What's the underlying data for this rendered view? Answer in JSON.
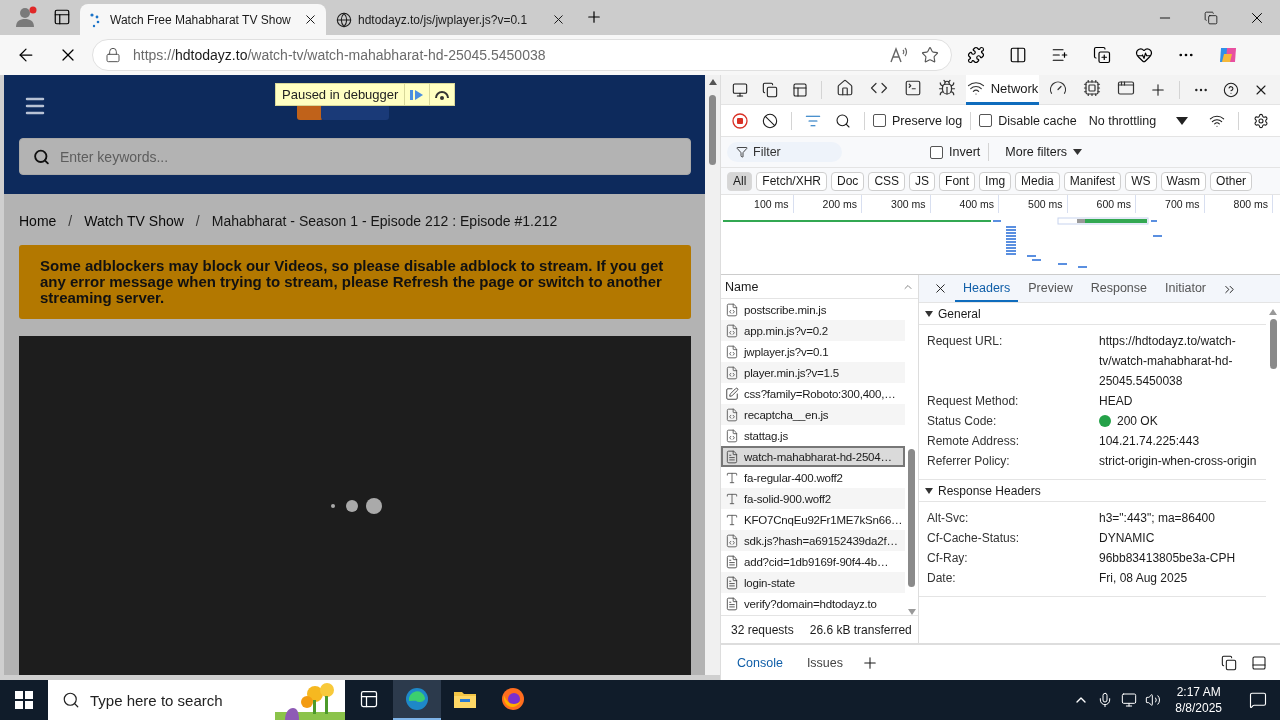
{
  "browser": {
    "tabs": [
      {
        "title": "Watch Free Mahabharat TV Show",
        "kind": "loading",
        "selected": true
      },
      {
        "title": "hdtodayz.to/js/jwplayer.js?v=0.1",
        "kind": "globe",
        "selected": false
      }
    ],
    "address": {
      "scheme": "https://",
      "host": "hdtodayz.to",
      "path": "/watch-tv/watch-mahabharat-hd-25045.5450038"
    },
    "loading": true
  },
  "page": {
    "debugger_badge": "Paused in debugger",
    "search": {
      "placeholder": "Enter keywords..."
    },
    "breadcrumbs": [
      {
        "label": "Home",
        "kind": "link"
      },
      {
        "label": "/",
        "kind": "separator"
      },
      {
        "label": "Watch TV Show",
        "kind": "link"
      },
      {
        "label": "/",
        "kind": "separator"
      },
      {
        "label": "Mahabharat - Season 1 - Episode 212 : Episode #1.212",
        "kind": "current"
      }
    ],
    "notice": "Some adblockers may block our Videos, so please disable adblock to stream. If you get any error message when trying to stream, please Refresh the page or switch to another streaming server."
  },
  "devtools": {
    "panel_tabs": [
      {
        "kind": "home",
        "selected": false
      },
      {
        "kind": "elements",
        "selected": false
      },
      {
        "kind": "console",
        "selected": false
      },
      {
        "kind": "sources",
        "selected": false
      },
      {
        "kind": "network",
        "label": "Network",
        "selected": true
      },
      {
        "kind": "performance",
        "selected": false
      },
      {
        "kind": "memory",
        "selected": false
      },
      {
        "kind": "application",
        "selected": false
      }
    ],
    "recording": true,
    "preserve_log": {
      "label": "Preserve log",
      "checked": false
    },
    "disable_cache": {
      "label": "Disable cache",
      "checked": false
    },
    "throttling": "No throttling",
    "filter": {
      "placeholder": "Filter"
    },
    "invert": {
      "label": "Invert",
      "checked": false
    },
    "more_filters": "More filters",
    "type_filters": [
      {
        "label": "All",
        "selected": true
      },
      {
        "label": "Fetch/XHR",
        "selected": false
      },
      {
        "label": "Doc",
        "selected": false
      },
      {
        "label": "CSS",
        "selected": false
      },
      {
        "label": "JS",
        "selected": false
      },
      {
        "label": "Font",
        "selected": false
      },
      {
        "label": "Img",
        "selected": false
      },
      {
        "label": "Media",
        "selected": false
      },
      {
        "label": "Manifest",
        "selected": false
      },
      {
        "label": "WS",
        "selected": false
      },
      {
        "label": "Wasm",
        "selected": false
      },
      {
        "label": "Other",
        "selected": false
      }
    ],
    "overview_ticks": [
      "100 ms",
      "200 ms",
      "300 ms",
      "400 ms",
      "500 ms",
      "600 ms",
      "700 ms",
      "800 ms"
    ],
    "name_column": "Name",
    "requests": [
      {
        "name": "postscribe.min.js",
        "kind": "script",
        "selected": false
      },
      {
        "name": "app.min.js?v=0.2",
        "kind": "script",
        "selected": false
      },
      {
        "name": "jwplayer.js?v=0.1",
        "kind": "script",
        "selected": false
      },
      {
        "name": "player.min.js?v=1.5",
        "kind": "script",
        "selected": false
      },
      {
        "name": "css?family=Roboto:300,400,…",
        "kind": "stylesheet",
        "selected": false
      },
      {
        "name": "recaptcha__en.js",
        "kind": "script",
        "selected": false
      },
      {
        "name": "stattag.js",
        "kind": "script",
        "selected": false
      },
      {
        "name": "watch-mahabharat-hd-2504…",
        "kind": "document",
        "selected": true
      },
      {
        "name": "fa-regular-400.woff2",
        "kind": "font",
        "selected": false
      },
      {
        "name": "fa-solid-900.woff2",
        "kind": "font",
        "selected": false
      },
      {
        "name": "KFO7CnqEu92Fr1ME7kSn66…",
        "kind": "font",
        "selected": false
      },
      {
        "name": "sdk.js?hash=a69152439da2f…",
        "kind": "script",
        "selected": false
      },
      {
        "name": "add?cid=1db9169f-90f4-4b…",
        "kind": "document",
        "selected": false
      },
      {
        "name": "login-state",
        "kind": "document",
        "selected": false
      },
      {
        "name": "verify?domain=hdtodayz.to",
        "kind": "document",
        "selected": false
      }
    ],
    "summary": {
      "requests": "32 requests",
      "transferred": "26.6 kB transferred"
    },
    "detail_tabs": [
      {
        "label": "Headers",
        "selected": true
      },
      {
        "label": "Preview",
        "selected": false
      },
      {
        "label": "Response",
        "selected": false
      },
      {
        "label": "Initiator",
        "selected": false
      }
    ],
    "sections": [
      {
        "title": "General",
        "expanded": true,
        "rows": [
          {
            "name": "Request URL:",
            "value": "https://hdtodayz.to/watch-tv/watch-mahabharat-hd-25045.5450038",
            "kind": "text"
          },
          {
            "name": "Request Method:",
            "value": "HEAD",
            "kind": "text"
          },
          {
            "name": "Status Code:",
            "value": "200 OK",
            "kind": "status"
          },
          {
            "name": "Remote Address:",
            "value": "104.21.74.225:443",
            "kind": "text"
          },
          {
            "name": "Referrer Policy:",
            "value": "strict-origin-when-cross-origin",
            "kind": "text"
          }
        ]
      },
      {
        "title": "Response Headers",
        "expanded": true,
        "rows": [
          {
            "name": "Alt-Svc:",
            "value": "h3=\":443\"; ma=86400",
            "kind": "text"
          },
          {
            "name": "Cf-Cache-Status:",
            "value": "DYNAMIC",
            "kind": "text"
          },
          {
            "name": "Cf-Ray:",
            "value": "96bb83413805be3a-CPH",
            "kind": "text"
          },
          {
            "name": "Date:",
            "value": "Fri, 08 Aug 2025",
            "kind": "text"
          }
        ]
      }
    ],
    "drawer_tabs": [
      {
        "label": "Console",
        "selected": true
      },
      {
        "label": "Issues",
        "selected": false
      }
    ]
  },
  "taskbar": {
    "search": {
      "placeholder": "Type here to search"
    },
    "apps": [
      {
        "kind": "task-view",
        "selected": false
      },
      {
        "kind": "edge",
        "selected": true
      },
      {
        "kind": "explorer",
        "selected": false
      },
      {
        "kind": "firefox",
        "selected": false
      }
    ],
    "time": "2:17 AM",
    "date": "8/8/2025"
  }
}
